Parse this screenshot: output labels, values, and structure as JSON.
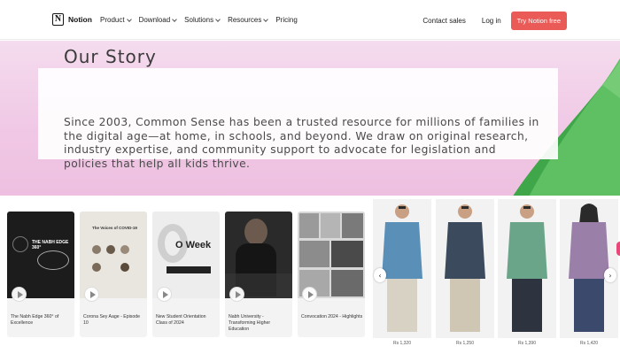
{
  "nav": {
    "brand": "Notion",
    "brand_mark": "N",
    "menu": [
      {
        "label": "Product",
        "dropdown": true
      },
      {
        "label": "Download",
        "dropdown": true
      },
      {
        "label": "Solutions",
        "dropdown": true
      },
      {
        "label": "Resources",
        "dropdown": true
      },
      {
        "label": "Pricing",
        "dropdown": false
      }
    ],
    "contact_sales": "Contact sales",
    "login": "Log in",
    "cta": "Try Notion free",
    "cta_color": "#ea5a56"
  },
  "hero": {
    "title": "Our Story",
    "body": "Since 2003, Common Sense has been a trusted resource for millions of families in the digital age—at home, in schools, and beyond. We draw on original research, industry expertise, and community support to advocate for legislation and policies that help all kids thrive."
  },
  "videos": [
    {
      "caption": "The Nabh Edge 360° of Excellence",
      "thumb_text": "THE NABH EDGE 360°"
    },
    {
      "caption": "Corona Sey Aage - Episode 10",
      "thumb_text": "The Voices of COVID-19"
    },
    {
      "caption": "New Student Orientation Class of 2024",
      "thumb_text": "O Week"
    },
    {
      "caption": "Nabh University - Transforming Higher Education",
      "thumb_text": ""
    },
    {
      "caption": "Convocation 2024 - Highlights",
      "thumb_text": ""
    }
  ],
  "products": [
    {
      "price": "Rs 1,320",
      "shirt_color": "#5a8fb8"
    },
    {
      "price": "Rs 1,250",
      "shirt_color": "#3b4a5c"
    },
    {
      "price": "Rs 1,390",
      "shirt_color": "#6aa58a"
    },
    {
      "price": "Rs 1,420",
      "shirt_color": "#9a7fa8"
    }
  ],
  "arrows": {
    "prev": "‹",
    "next": "›"
  }
}
